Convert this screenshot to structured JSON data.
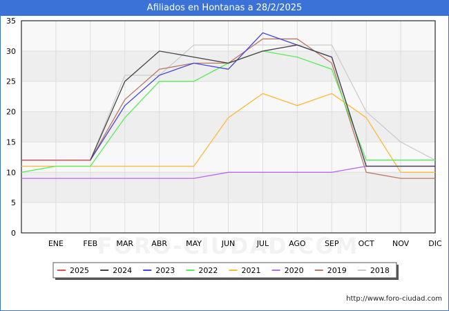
{
  "title": "Afiliados en Hontanas a 28/2/2025",
  "footer_url": "http://www.foro-ciudad.com",
  "watermark": "FORO-CIUDAD.COM",
  "chart_data": {
    "type": "line",
    "title": "Afiliados en Hontanas a 28/2/2025",
    "categories": [
      "",
      "ENE",
      "FEB",
      "MAR",
      "ABR",
      "MAY",
      "JUN",
      "JUL",
      "AGO",
      "SEP",
      "OCT",
      "NOV",
      "DIC"
    ],
    "ylim": [
      0,
      35
    ],
    "yticks": [
      0,
      5,
      10,
      15,
      20,
      25,
      30,
      35
    ],
    "grid": true,
    "legend_position": "bottom",
    "series": [
      {
        "name": "2025",
        "color": "#e05050",
        "values": [
          12,
          12,
          12
        ]
      },
      {
        "name": "2024",
        "color": "#444444",
        "values": [
          12,
          12,
          12,
          25,
          30,
          29,
          28,
          30,
          31,
          29,
          11,
          11,
          11
        ]
      },
      {
        "name": "2023",
        "color": "#4444dd",
        "values": [
          12,
          12,
          12,
          21,
          26,
          28,
          27,
          33,
          31,
          29,
          11,
          11,
          11
        ]
      },
      {
        "name": "2022",
        "color": "#55ee55",
        "values": [
          10,
          11,
          11,
          19,
          25,
          25,
          28,
          30,
          29,
          27,
          12,
          12,
          12
        ]
      },
      {
        "name": "2021",
        "color": "#ffb833",
        "values": [
          11,
          11,
          11,
          11,
          11,
          11,
          19,
          23,
          21,
          23,
          19,
          10,
          10
        ]
      },
      {
        "name": "2020",
        "color": "#bb66ee",
        "values": [
          9,
          9,
          9,
          9,
          9,
          9,
          10,
          10,
          10,
          10,
          11,
          11,
          11
        ]
      },
      {
        "name": "2019",
        "color": "#bb7766",
        "values": [
          12,
          12,
          12,
          22,
          27,
          28,
          28,
          32,
          32,
          28,
          10,
          9,
          9
        ]
      },
      {
        "name": "2018",
        "color": "#cccccc",
        "values": [
          12,
          12,
          12,
          26,
          26,
          31,
          31,
          31,
          31,
          31,
          20,
          15,
          12
        ]
      }
    ]
  }
}
